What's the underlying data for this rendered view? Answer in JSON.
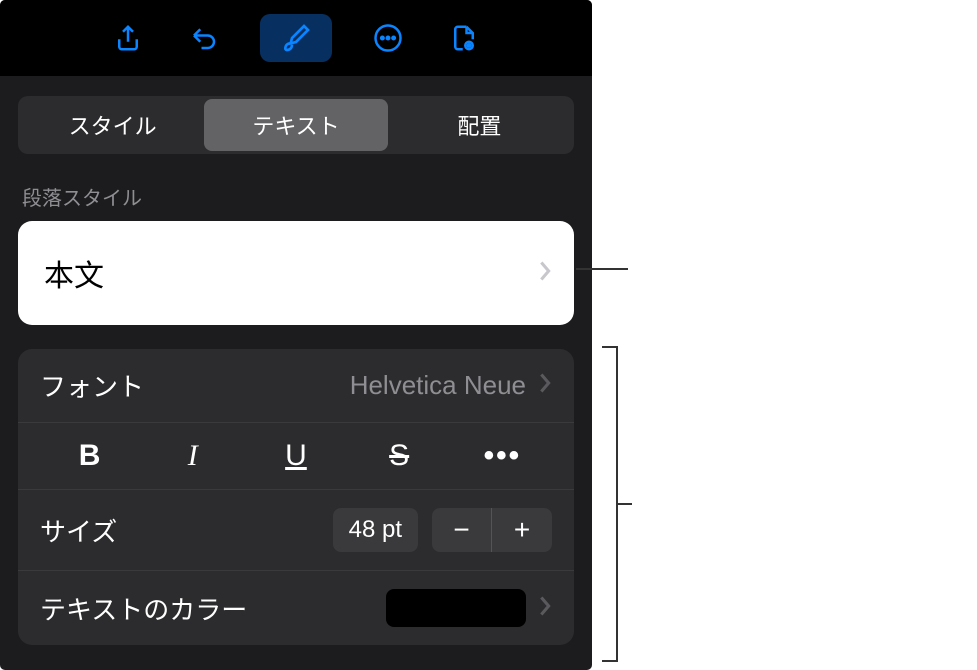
{
  "segments": {
    "style": "スタイル",
    "text": "テキスト",
    "layout": "配置"
  },
  "paragraphStyle": {
    "label": "段落スタイル",
    "value": "本文"
  },
  "font": {
    "label": "フォント",
    "value": "Helvetica Neue"
  },
  "styleButtons": {
    "bold": "B",
    "italic": "I",
    "underline": "U",
    "strike": "S",
    "more": "•••"
  },
  "size": {
    "label": "サイズ",
    "value": "48 pt",
    "minus": "−",
    "plus": "+"
  },
  "textColor": {
    "label": "テキストのカラー"
  }
}
